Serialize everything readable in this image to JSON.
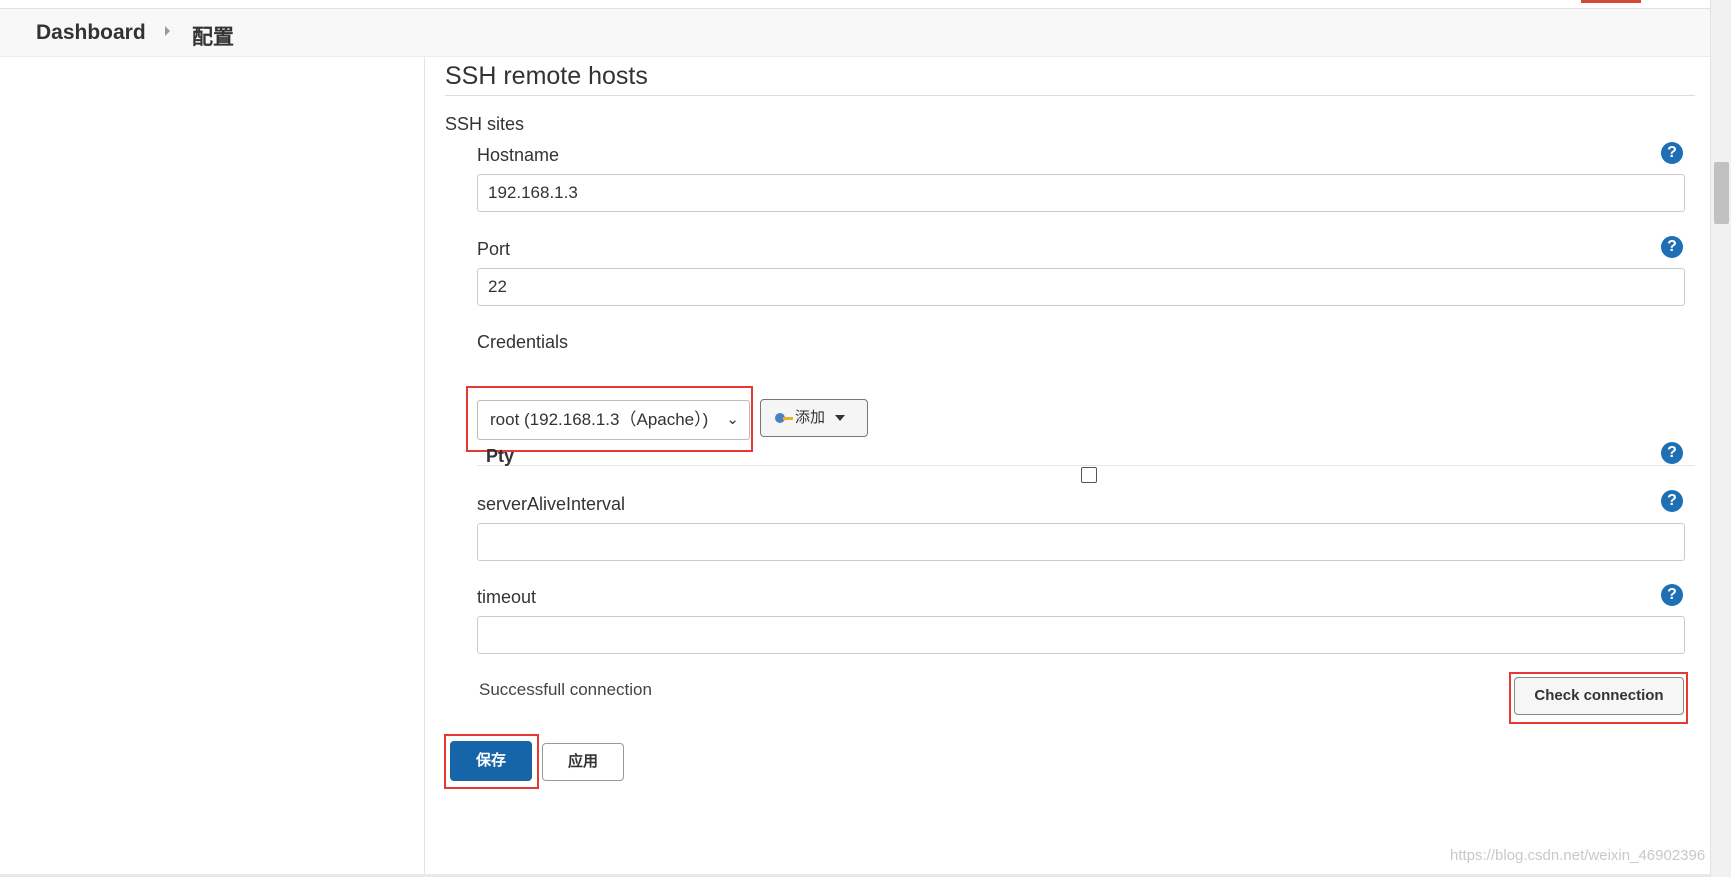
{
  "breadcrumb": {
    "home": "Dashboard",
    "current": "配置"
  },
  "section": {
    "title": "SSH remote hosts",
    "subtitle": "SSH sites"
  },
  "hostname": {
    "label": "Hostname",
    "value": "192.168.1.3"
  },
  "port": {
    "label": "Port",
    "value": "22"
  },
  "credentials": {
    "label": "Credentials",
    "selected": "root (192.168.1.3（Apache）)",
    "add_label": "添加"
  },
  "pty": {
    "label": "Pty",
    "checked": false
  },
  "server_alive_interval": {
    "label": "serverAliveInterval",
    "value": ""
  },
  "timeout": {
    "label": "timeout",
    "value": ""
  },
  "status": {
    "text": "Successfull connection"
  },
  "buttons": {
    "check": "Check connection",
    "save": "保存",
    "apply": "应用"
  },
  "help_glyph": "?",
  "watermark": "https://blog.csdn.net/weixin_46902396",
  "colors": {
    "primary": "#1565a8",
    "help": "#1f6fb5",
    "highlight": "#e53935"
  }
}
